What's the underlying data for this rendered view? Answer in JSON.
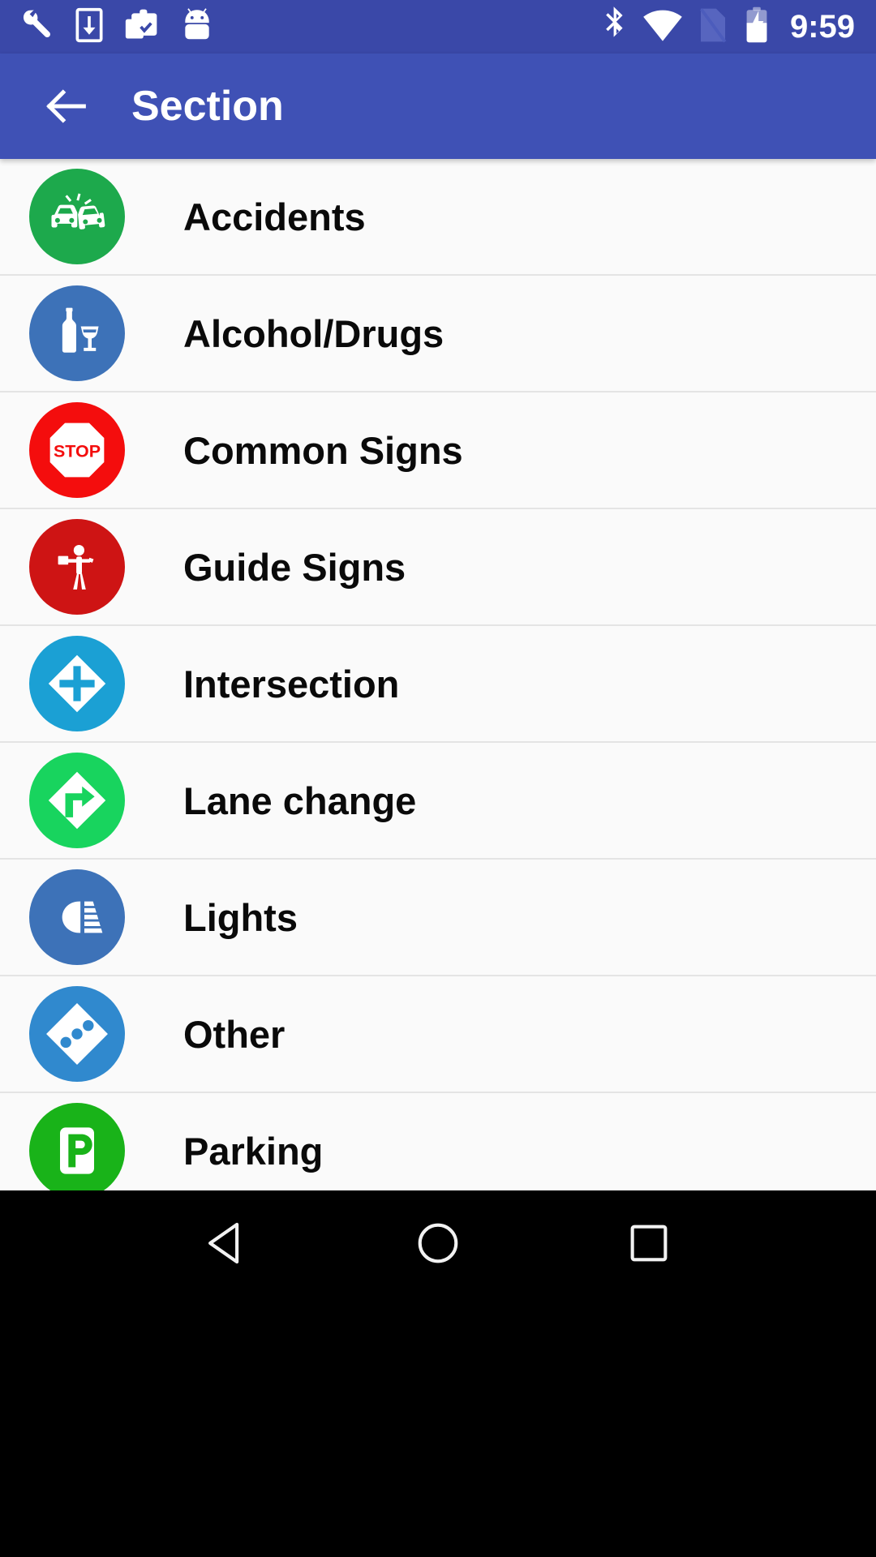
{
  "status_bar": {
    "background_color": "#3A48A8",
    "clock": "9:59",
    "left_icons": [
      {
        "name": "wrench-icon",
        "label": "developer tools"
      },
      {
        "name": "phone-download-icon",
        "label": "download to device"
      },
      {
        "name": "clipboard-check-icon",
        "label": "clipboard"
      },
      {
        "name": "android-robot-icon",
        "label": "android"
      }
    ],
    "right_icons": [
      {
        "name": "bluetooth-icon",
        "label": "bluetooth"
      },
      {
        "name": "wifi-icon",
        "label": "wifi full"
      },
      {
        "name": "no-sim-icon",
        "label": "no sim card"
      },
      {
        "name": "battery-charging-icon",
        "label": "battery charging"
      }
    ]
  },
  "app_bar": {
    "background_color": "#3F51B5",
    "back_label": "Back",
    "title": "Section"
  },
  "list": {
    "background_color": "#FAFAFA",
    "divider_color": "#E4E4E4",
    "items": [
      {
        "id": "accidents",
        "label": "Accidents",
        "icon": "car-crash-icon",
        "badge_color": "#1DA94C"
      },
      {
        "id": "alcohol-drugs",
        "label": "Alcohol/Drugs",
        "icon": "bottle-glass-icon",
        "badge_color": "#3D72B8"
      },
      {
        "id": "common-signs",
        "label": "Common Signs",
        "icon": "stop-sign-icon",
        "badge_color": "#F40D0D",
        "sign_text": "STOP"
      },
      {
        "id": "guide-signs",
        "label": "Guide Signs",
        "icon": "flagger-person-icon",
        "badge_color": "#CE1414"
      },
      {
        "id": "intersection",
        "label": "Intersection",
        "icon": "crossroad-diamond-icon",
        "badge_color": "#1BA0D4"
      },
      {
        "id": "lane-change",
        "label": "Lane change",
        "icon": "turn-right-diamond-icon",
        "badge_color": "#18D45E"
      },
      {
        "id": "lights",
        "label": "Lights",
        "icon": "headlight-icon",
        "badge_color": "#3D72B8"
      },
      {
        "id": "other",
        "label": "Other",
        "icon": "dots-diamond-icon",
        "badge_color": "#3089CE"
      },
      {
        "id": "parking",
        "label": "Parking",
        "icon": "parking-p-icon",
        "badge_color": "#19B319"
      }
    ]
  },
  "nav_bar": {
    "background_color": "#000000",
    "buttons": [
      {
        "name": "nav-back-button",
        "label": "Back"
      },
      {
        "name": "nav-home-button",
        "label": "Home"
      },
      {
        "name": "nav-recents-button",
        "label": "Recents"
      }
    ]
  }
}
